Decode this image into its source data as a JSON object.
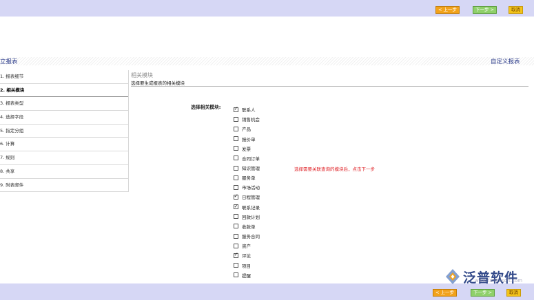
{
  "buttons": {
    "prev": "< 上一步",
    "next": "下一步 >",
    "cancel": "取消"
  },
  "header": {
    "left_title": "立报表",
    "right_title": "自定义报表"
  },
  "steps": [
    "1. 报表细节",
    "2. 相关模块",
    "3. 报表类型",
    "4. 选择字段",
    "5. 指定分组",
    "6. 计算",
    "7. 规则",
    "8. 共享",
    "9. 附表邮件"
  ],
  "section": {
    "title": "相关模块",
    "subtitle": "选择要生成报表的相关模块"
  },
  "field_label": "选择相关模块:",
  "modules": [
    {
      "label": "联系人",
      "checked": true
    },
    {
      "label": "销售机会",
      "checked": false
    },
    {
      "label": "产品",
      "checked": false
    },
    {
      "label": "报价单",
      "checked": false
    },
    {
      "label": "发票",
      "checked": false
    },
    {
      "label": "合同订单",
      "checked": false
    },
    {
      "label": "知识管理",
      "checked": false
    },
    {
      "label": "服务单",
      "checked": false
    },
    {
      "label": "市场活动",
      "checked": false
    },
    {
      "label": "日程管理",
      "checked": true
    },
    {
      "label": "联系记录",
      "checked": true
    },
    {
      "label": "回款计划",
      "checked": false
    },
    {
      "label": "收款单",
      "checked": false
    },
    {
      "label": "服务合同",
      "checked": false
    },
    {
      "label": "资产",
      "checked": false
    },
    {
      "label": "评论",
      "checked": true
    },
    {
      "label": "项目",
      "checked": false
    },
    {
      "label": "提醒",
      "checked": false
    }
  ],
  "hint": "选择需要关联查询的模块后，点击下一步",
  "logo": {
    "text": "泛普软件",
    "url": "www.fanpusoft.com"
  },
  "colors": {
    "bar": "#d6d7f5",
    "hint": "#e0262b",
    "title": "#2a3a8a",
    "prev": "#f2a21a",
    "next": "#8fd06a",
    "cancel": "#f2c31a"
  }
}
